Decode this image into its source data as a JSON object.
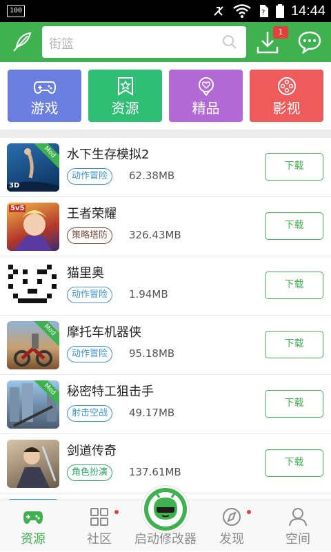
{
  "status_bar": {
    "left_badge": "100",
    "time": "14:44"
  },
  "header": {
    "search_placeholder": "街篮",
    "download_badge": "1"
  },
  "categories": [
    {
      "label": "游戏",
      "color": "#6b7fe0",
      "icon": "gamepad-icon"
    },
    {
      "label": "资源",
      "color": "#2fbf74",
      "icon": "bookmark-star-icon"
    },
    {
      "label": "精品",
      "color": "#b36ad6",
      "icon": "heart-badge-icon"
    },
    {
      "label": "影视",
      "color": "#ef5b5b",
      "icon": "film-reel-icon"
    }
  ],
  "apps": [
    {
      "name": "水下生存模拟2",
      "tag": "动作冒险",
      "tag_color": "#3a93d8",
      "size": "62.38MB",
      "mod": true,
      "thumb_badge": "3D",
      "download": "下载"
    },
    {
      "name": "王者荣耀",
      "tag": "策略塔防",
      "tag_color": "#7a4a3a",
      "size": "326.43MB",
      "mod": false,
      "thumb_badge": "5v5",
      "download": "下载"
    },
    {
      "name": "猫里奥",
      "tag": "动作冒险",
      "tag_color": "#3a93d8",
      "size": "1.94MB",
      "mod": false,
      "thumb_badge": "",
      "download": "下载"
    },
    {
      "name": "摩托车机器侠",
      "tag": "动作冒险",
      "tag_color": "#3a93d8",
      "size": "95.18MB",
      "mod": true,
      "thumb_badge": "",
      "download": "下载"
    },
    {
      "name": "秘密特工狙击手",
      "tag": "射击空战",
      "tag_color": "#3a93d8",
      "size": "49.17MB",
      "mod": true,
      "thumb_badge": "",
      "download": "下载"
    },
    {
      "name": "剑道传奇",
      "tag": "角色扮演",
      "tag_color": "#2aa866",
      "size": "137.61MB",
      "mod": false,
      "thumb_badge": "",
      "download": "下载"
    }
  ],
  "mod_label": "Mod",
  "bottom_nav": [
    {
      "label": "资源",
      "active": true,
      "icon": "gamepad-icon"
    },
    {
      "label": "社区",
      "active": false,
      "icon": "grid-icon",
      "dot": true
    },
    {
      "label": "启动修改器",
      "active": false,
      "icon": "launcher-mascot-icon"
    },
    {
      "label": "发现",
      "active": false,
      "icon": "compass-icon",
      "dot": true
    },
    {
      "label": "空间",
      "active": false,
      "icon": "user-icon"
    }
  ],
  "colors": {
    "brand_green": "#3fb24f",
    "badge_red": "#e0413a"
  }
}
